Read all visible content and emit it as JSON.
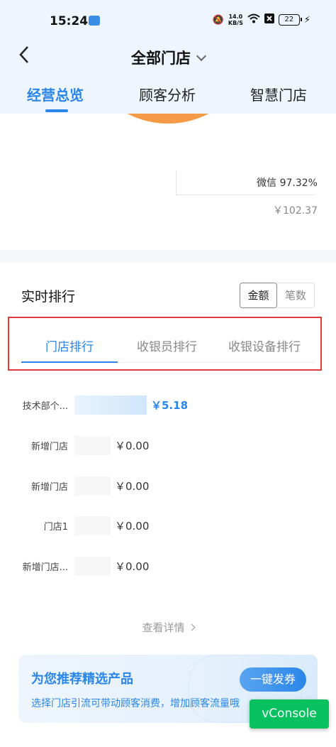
{
  "status_bar": {
    "time": "15:24",
    "speed_value": "14.0",
    "speed_unit": "KB/S",
    "battery": "22"
  },
  "header": {
    "title": "全部门店",
    "tabs": [
      {
        "label": "经营总览",
        "active": true
      },
      {
        "label": "顾客分析",
        "active": false
      },
      {
        "label": "智慧门店",
        "active": false
      }
    ]
  },
  "donut": {
    "color": "#f59a47",
    "label": "微信 97.32%",
    "amount": "￥102.37"
  },
  "ranking": {
    "title": "实时排行",
    "toggle": [
      {
        "label": "金额",
        "active": true
      },
      {
        "label": "笔数",
        "active": false
      }
    ],
    "sub_tabs": [
      {
        "label": "门店排行",
        "active": true
      },
      {
        "label": "收银员排行",
        "active": false
      },
      {
        "label": "收银设备排行",
        "active": false
      }
    ],
    "rows": [
      {
        "name": "技术部个...",
        "value": "￥5.18"
      },
      {
        "name": "新增门店",
        "value": "￥0.00"
      },
      {
        "name": "新增门店",
        "value": "￥0.00"
      },
      {
        "name": "门店1",
        "value": "￥0.00"
      },
      {
        "name": "新增门店...",
        "value": "￥0.00"
      }
    ],
    "detail_link": "查看详情"
  },
  "promo": {
    "title": "为您推荐精选产品",
    "subtitle": "选择门店引流可带动顾客消费，增加顾客流量哦",
    "button": "一键发券"
  },
  "vconsole": {
    "label": "vConsole"
  },
  "colors": {
    "accent": "#2a86e8",
    "highlight_box": "#e03a3a",
    "donut": "#f59a47",
    "vconsole": "#07c160"
  }
}
